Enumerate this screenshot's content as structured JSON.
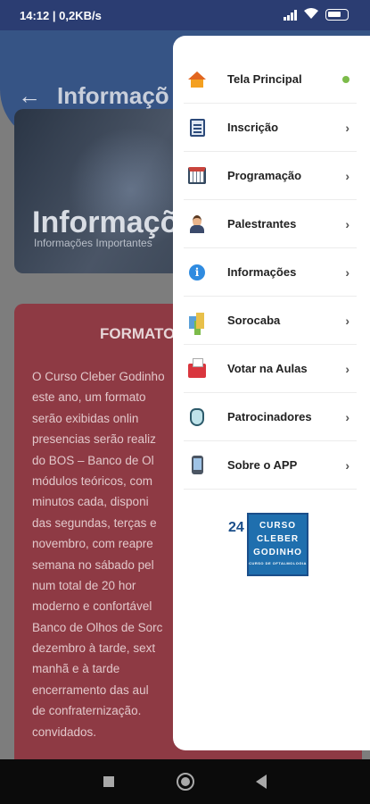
{
  "status_bar": {
    "time_net": "14:12 | 0,2KB/s",
    "battery": "90"
  },
  "header": {
    "back_icon": "arrow-left-icon",
    "title": "Informaçõ"
  },
  "banner": {
    "title": "Informaçõ",
    "subtitle": "Informações Importantes"
  },
  "card": {
    "heading": "FORMATO",
    "lines": [
      "O Curso Cleber Godinho",
      "este ano, um formato",
      "serão exibidas onlin",
      "presencias serão realiz",
      "do BOS – Banco de Ol",
      "módulos teóricos, com",
      "minutos cada, disponi",
      "das segundas, terças e",
      "novembro, com reapre",
      "semana no sábado pel",
      "num total de 20 hor",
      "moderno e confortável",
      "Banco de Olhos de Sorc",
      "dezembro à tarde, sext",
      "manhã e à tarde",
      "encerramento das aul",
      "de confraternização.",
      "convidados."
    ]
  },
  "drawer": {
    "items": [
      {
        "label": "Tela Principal",
        "icon": "house-icon",
        "indicator": "active-dot"
      },
      {
        "label": "Inscrição",
        "icon": "form-icon",
        "indicator": "chevron"
      },
      {
        "label": "Programação",
        "icon": "calendar-icon",
        "indicator": "chevron"
      },
      {
        "label": "Palestrantes",
        "icon": "speaker-icon",
        "indicator": "chevron"
      },
      {
        "label": "Informações",
        "icon": "info-icon",
        "indicator": "chevron"
      },
      {
        "label": "Sorocaba",
        "icon": "city-icon",
        "indicator": "chevron"
      },
      {
        "label": "Votar na Aulas",
        "icon": "ballot-icon",
        "indicator": "chevron"
      },
      {
        "label": "Patrocinadores",
        "icon": "shield-icon",
        "indicator": "chevron"
      },
      {
        "label": "Sobre o APP",
        "icon": "phone-icon",
        "indicator": "chevron"
      }
    ],
    "chevron": "›",
    "logo": {
      "edition": "24",
      "lines": [
        "CURSO",
        "CLEBER",
        "GODINHO"
      ],
      "tagline": "CURSO DE OFTALMOLOGIA"
    }
  },
  "colors": {
    "drawer_active": "#7cbb4a",
    "card": "#8e3a44",
    "header": "#365485",
    "status_bar": "#2b3d72"
  }
}
